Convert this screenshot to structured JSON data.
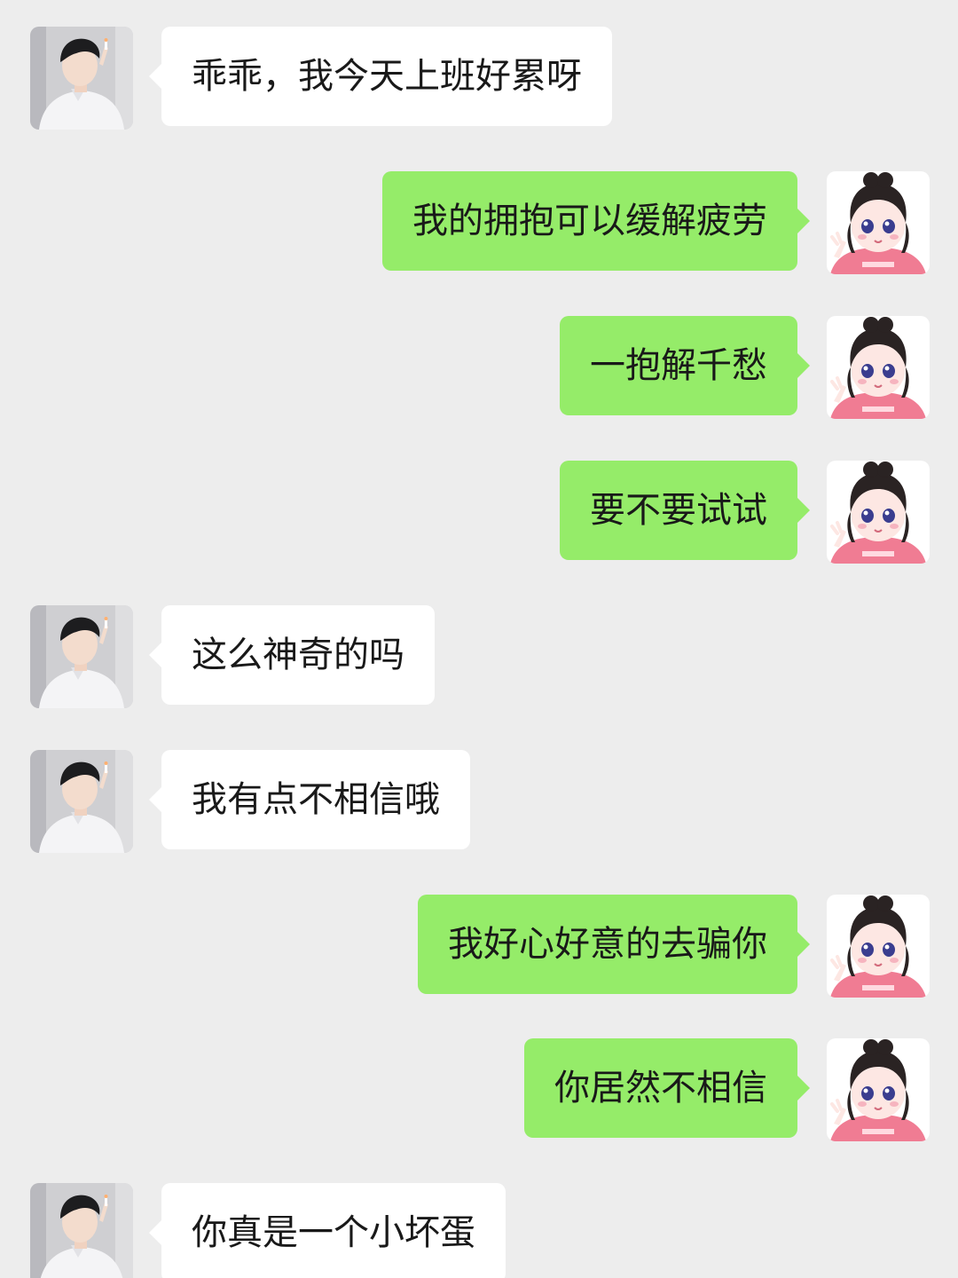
{
  "colors": {
    "background": "#ededed",
    "incoming_bubble": "#ffffff",
    "outgoing_bubble": "#95ec69",
    "text": "#191919"
  },
  "avatars": {
    "incoming": "boy-avatar-icon",
    "outgoing": "cartoon-girl-avatar-icon"
  },
  "messages": [
    {
      "side": "incoming",
      "text": "乖乖，我今天上班好累呀"
    },
    {
      "side": "outgoing",
      "text": "我的拥抱可以缓解疲劳"
    },
    {
      "side": "outgoing",
      "text": "一抱解千愁"
    },
    {
      "side": "outgoing",
      "text": "要不要试试"
    },
    {
      "side": "incoming",
      "text": "这么神奇的吗"
    },
    {
      "side": "incoming",
      "text": "我有点不相信哦"
    },
    {
      "side": "outgoing",
      "text": "我好心好意的去骗你"
    },
    {
      "side": "outgoing",
      "text": "你居然不相信"
    },
    {
      "side": "incoming",
      "text": "你真是一个小坏蛋"
    }
  ]
}
